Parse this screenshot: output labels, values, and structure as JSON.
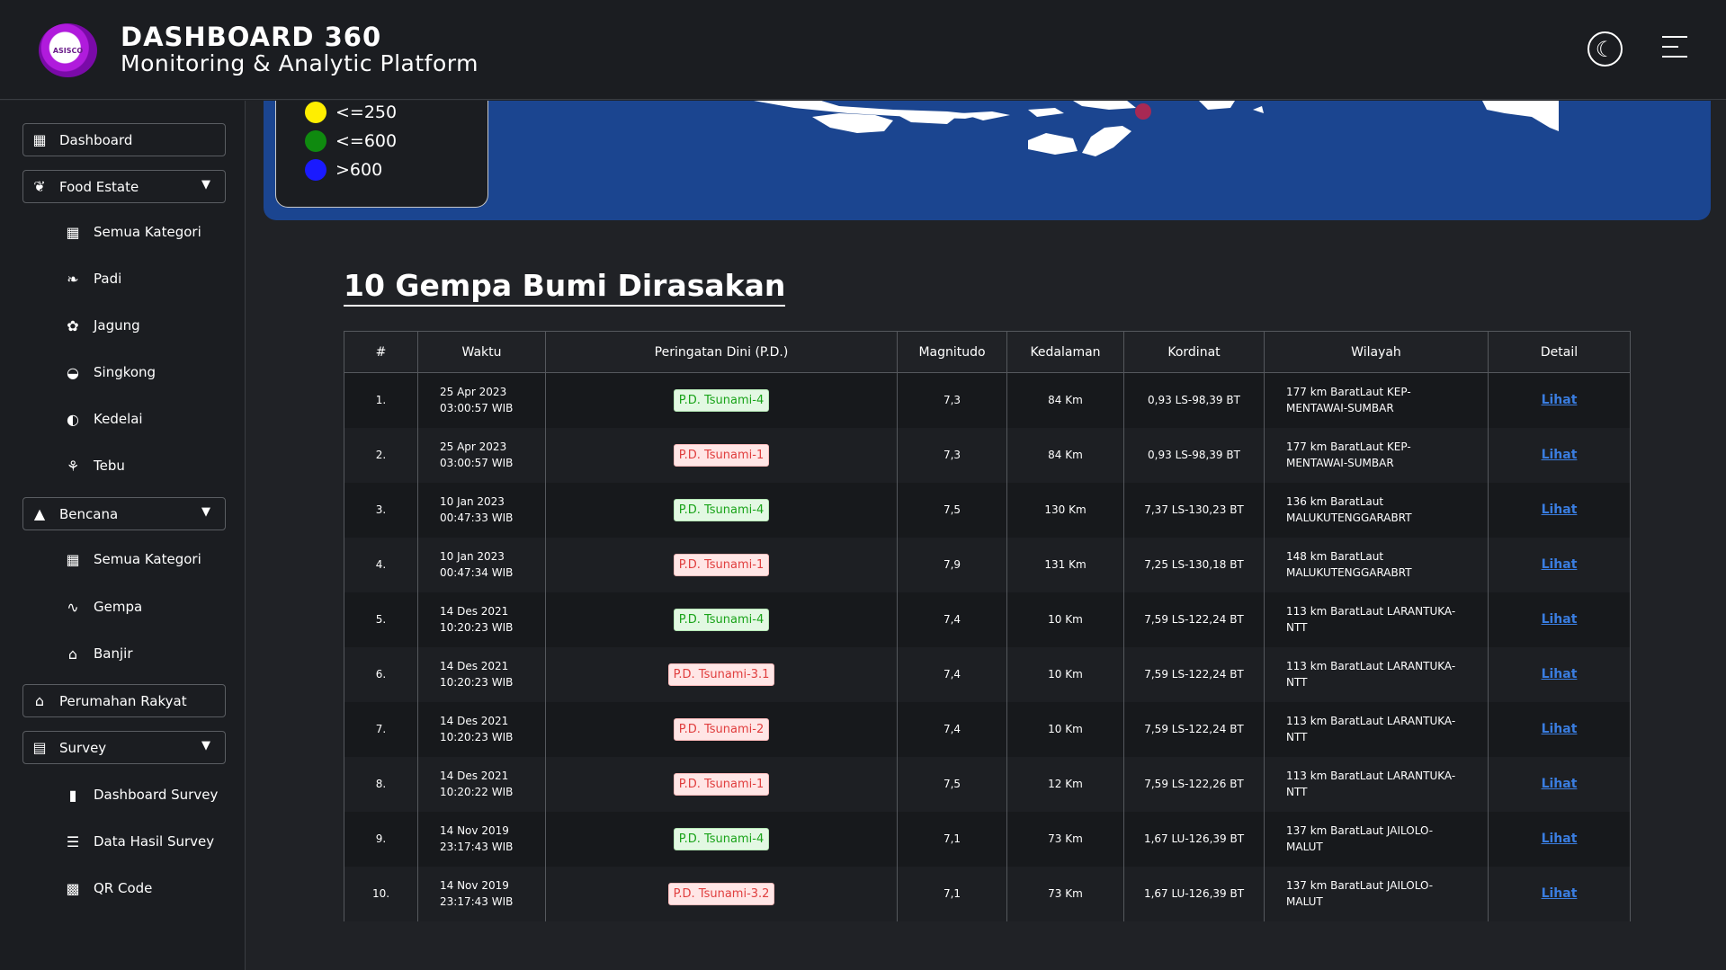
{
  "header": {
    "logo_text": "ASISCO",
    "title": "DASHBOARD 360",
    "subtitle": "Monitoring & Analytic Platform",
    "theme_icon": "moon-icon",
    "menu_icon": "hamburger-icon"
  },
  "sidebar": {
    "dashboard": "Dashboard",
    "food_estate": "Food Estate",
    "food_items": [
      "Semua Kategori",
      "Padi",
      "Jagung",
      "Singkong",
      "Kedelai",
      "Tebu"
    ],
    "bencana": "Bencana",
    "bencana_items": [
      "Semua Kategori",
      "Gempa",
      "Banjir"
    ],
    "perumahan": "Perumahan Rakyat",
    "survey": "Survey",
    "survey_items": [
      "Dashboard Survey",
      "Data Hasil Survey",
      "QR Code"
    ]
  },
  "legend": {
    "items": [
      {
        "label": "<=250",
        "color": "#ffee00"
      },
      {
        "label": "<=600",
        "color": "#0f8a0f"
      },
      {
        "label": ">600",
        "color": "#1a1aff"
      }
    ]
  },
  "section_title": "10 Gempa Bumi Dirasakan",
  "table": {
    "headers": [
      "#",
      "Waktu",
      "Peringatan Dini (P.D.)",
      "Magnitudo",
      "Kedalaman",
      "Kordinat",
      "Wilayah",
      "Detail"
    ],
    "rows": [
      {
        "no": "1.",
        "date": "25 Apr 2023",
        "time": "03:00:57 WIB",
        "pd": "P.D. Tsunami-4",
        "pd_color": "green",
        "mag": "7,3",
        "depth": "84 Km",
        "coord": "0,93 LS-98,39 BT",
        "wil1": "177 km BaratLaut KEP-",
        "wil2": "MENTAWAI-SUMBAR",
        "detail": "Lihat"
      },
      {
        "no": "2.",
        "date": "25 Apr 2023",
        "time": "03:00:57 WIB",
        "pd": "P.D. Tsunami-1",
        "pd_color": "red",
        "mag": "7,3",
        "depth": "84 Km",
        "coord": "0,93 LS-98,39 BT",
        "wil1": "177 km BaratLaut KEP-",
        "wil2": "MENTAWAI-SUMBAR",
        "detail": "Lihat"
      },
      {
        "no": "3.",
        "date": "10 Jan 2023",
        "time": "00:47:33 WIB",
        "pd": "P.D. Tsunami-4",
        "pd_color": "green",
        "mag": "7,5",
        "depth": "130 Km",
        "coord": "7,37 LS-130,23 BT",
        "wil1": "136 km BaratLaut",
        "wil2": "MALUKUTENGGARABRT",
        "detail": "Lihat"
      },
      {
        "no": "4.",
        "date": "10 Jan 2023",
        "time": "00:47:34 WIB",
        "pd": "P.D. Tsunami-1",
        "pd_color": "red",
        "mag": "7,9",
        "depth": "131 Km",
        "coord": "7,25 LS-130,18 BT",
        "wil1": "148 km BaratLaut",
        "wil2": "MALUKUTENGGARABRT",
        "detail": "Lihat"
      },
      {
        "no": "5.",
        "date": "14 Des 2021",
        "time": "10:20:23 WIB",
        "pd": "P.D. Tsunami-4",
        "pd_color": "green",
        "mag": "7,4",
        "depth": "10 Km",
        "coord": "7,59 LS-122,24 BT",
        "wil1": "113 km BaratLaut LARANTUKA-",
        "wil2": "NTT",
        "detail": "Lihat"
      },
      {
        "no": "6.",
        "date": "14 Des 2021",
        "time": "10:20:23 WIB",
        "pd": "P.D. Tsunami-3.1",
        "pd_color": "red",
        "mag": "7,4",
        "depth": "10 Km",
        "coord": "7,59 LS-122,24 BT",
        "wil1": "113 km BaratLaut LARANTUKA-",
        "wil2": "NTT",
        "detail": "Lihat"
      },
      {
        "no": "7.",
        "date": "14 Des 2021",
        "time": "10:20:23 WIB",
        "pd": "P.D. Tsunami-2",
        "pd_color": "red",
        "mag": "7,4",
        "depth": "10 Km",
        "coord": "7,59 LS-122,24 BT",
        "wil1": "113 km BaratLaut LARANTUKA-",
        "wil2": "NTT",
        "detail": "Lihat"
      },
      {
        "no": "8.",
        "date": "14 Des 2021",
        "time": "10:20:22 WIB",
        "pd": "P.D. Tsunami-1",
        "pd_color": "red",
        "mag": "7,5",
        "depth": "12 Km",
        "coord": "7,59 LS-122,26 BT",
        "wil1": "113 km BaratLaut LARANTUKA-",
        "wil2": "NTT",
        "detail": "Lihat"
      },
      {
        "no": "9.",
        "date": "14 Nov 2019",
        "time": "23:17:43 WIB",
        "pd": "P.D. Tsunami-4",
        "pd_color": "green",
        "mag": "7,1",
        "depth": "73 Km",
        "coord": "1,67 LU-126,39 BT",
        "wil1": "137 km BaratLaut JAILOLO-",
        "wil2": "MALUT",
        "detail": "Lihat"
      },
      {
        "no": "10.",
        "date": "14 Nov 2019",
        "time": "23:17:43 WIB",
        "pd": "P.D. Tsunami-3.2",
        "pd_color": "red",
        "mag": "7,1",
        "depth": "73 Km",
        "coord": "1,67 LU-126,39 BT",
        "wil1": "137 km BaratLaut JAILOLO-",
        "wil2": "MALUT",
        "detail": "Lihat"
      }
    ]
  }
}
